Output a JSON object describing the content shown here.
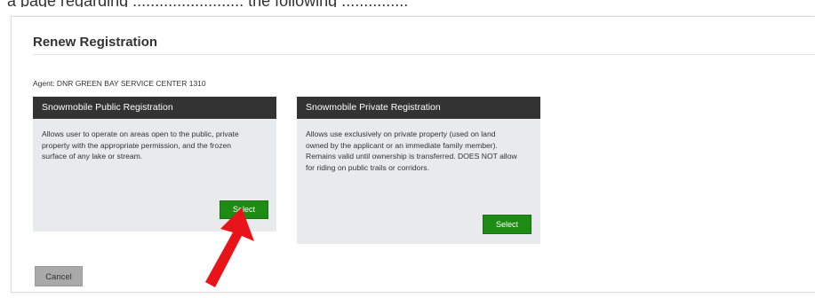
{
  "top_caption": "a page regarding ......................... the following ...............",
  "page_title": "Renew Registration",
  "agent_text": "Agent: DNR GREEN BAY SERVICE CENTER 1310",
  "cards": [
    {
      "title": "Snowmobile Public Registration",
      "description": "Allows user to operate on areas open to the public, private property with the appropriate permission, and the frozen surface of any lake or stream.",
      "button": "Select"
    },
    {
      "title": "Snowmobile Private Registration",
      "description": "Allows use exclusively on private property (used on land owned by the applicant or an immediate family member). Remains valid until ownership is transferred. DOES NOT allow for riding on public trails or corridors.",
      "button": "Select"
    }
  ],
  "cancel_label": "Cancel",
  "colors": {
    "card_header": "#333333",
    "card_body": "#e9eaeb",
    "select_button": "#1e8b14",
    "cancel_button": "#a9a9a9",
    "annotation_arrow": "#e8141a"
  },
  "annotation": {
    "icon": "red-arrow-icon",
    "points_to": "cards.0.button"
  }
}
